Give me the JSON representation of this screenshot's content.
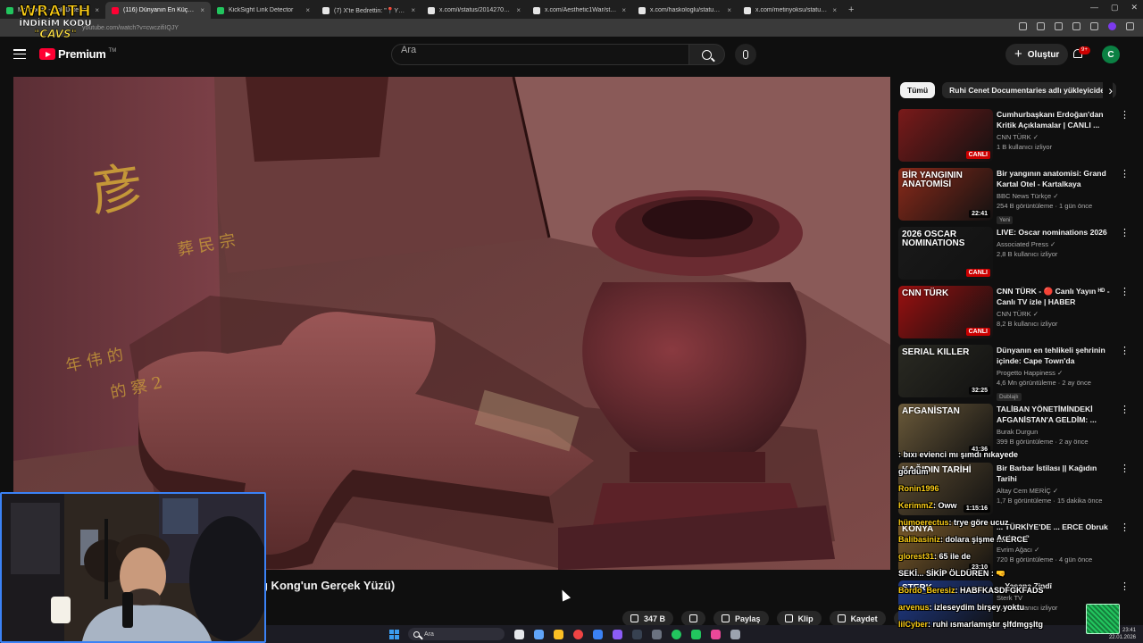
{
  "browser": {
    "tabs": [
      {
        "title": "MrNobody - Link Detector",
        "color": "#22c55e"
      },
      {
        "title": "(116) Dünyanın En Küçük Evi",
        "color": "#ff0033",
        "active": true
      },
      {
        "title": "KickSight Link Detector",
        "color": "#22c55e"
      },
      {
        "title": "(7) X'te Bedrettin: \"📍YENİ — ...",
        "color": "#e5e5e5"
      },
      {
        "title": "x.com/i/status/2014270035037",
        "color": "#e5e5e5"
      },
      {
        "title": "x.com/Aesthetic1War/status/20",
        "color": "#e5e5e5"
      },
      {
        "title": "x.com/haskologlu/status/2014",
        "color": "#e5e5e5"
      },
      {
        "title": "x.com/metinyoksu/status/2014",
        "color": "#e5e5e5"
      }
    ],
    "new_tab": "+",
    "tab_close": "×",
    "url": "youtube.com/watch?v=cwczifiIQJY",
    "window_controls": [
      "—",
      "▢",
      "✕"
    ]
  },
  "overlay_brand": {
    "line1": "WRAITH",
    "line2": "İNDİRİM KODU",
    "line3": "\"CAVS\""
  },
  "header": {
    "logo_text": "Premium",
    "logo_tm": "TM",
    "search_placeholder": "Ara",
    "create_label": "Oluştur",
    "create_plus": "+",
    "notification_badge": "9+",
    "account_initial": "C"
  },
  "video": {
    "title": "g Kong'un Gerçek Yüzü)",
    "actions": {
      "like_count": "347 B",
      "share_label": "Paylaş",
      "clip_label": "Klip",
      "save_label": "Kaydet",
      "more": "⋯"
    }
  },
  "sidebar": {
    "chips": [
      "Tümü",
      "Ruhi Cenet Documentaries adlı yükleyiciden"
    ],
    "chip_next": "›",
    "kebab": "⋮",
    "recommendations": [
      {
        "thumb_text": "",
        "badge": "CANLI",
        "bg": "#7a1a1a",
        "title": "Cumhurbaşkanı Erdoğan'dan Kritik Açıklamalar | CANLI ...",
        "channel": "CNN TÜRK ✓",
        "meta": "1 B kullanıcı izliyor",
        "extra": ""
      },
      {
        "thumb_text": "BİR YANGININ ANATOMİSİ",
        "badge": "22:41",
        "bg": "#8a2a1a",
        "title": "Bir yangının anatomisi: Grand Kartal Otel - Kartalkaya",
        "channel": "BBC News Türkçe ✓",
        "meta": "254 B görüntüleme · 1 gün önce",
        "extra": "Yeni"
      },
      {
        "thumb_text": "2026 OSCAR NOMINATIONS",
        "badge": "CANLI",
        "bg": "#1a1a1a",
        "title": "LIVE: Oscar nominations 2026",
        "channel": "Associated Press ✓",
        "meta": "2,8 B kullanıcı izliyor",
        "extra": ""
      },
      {
        "thumb_text": "CNN TÜRK",
        "badge": "CANLI",
        "bg": "#9a1010",
        "title": "CNN TÜRK - 🔴 Canlı Yayın ᴴᴰ - Canlı TV izle | HABER",
        "channel": "CNN TÜRK ✓",
        "meta": "8,2 B kullanıcı izliyor",
        "extra": ""
      },
      {
        "thumb_text": "SERIAL KILLER",
        "badge": "32:25",
        "bg": "#2a2a22",
        "title": "Dünyanın en tehlikeli şehrinin içinde: Cape Town'da yaşamak...",
        "channel": "Progetto Happiness ✓",
        "meta": "4,6 Mn görüntüleme · 2 ay önce",
        "extra": "Dublajlı"
      },
      {
        "thumb_text": "AFGANİSTAN",
        "badge": "41:36",
        "bg": "#6b5a3a",
        "title": "TALİBAN YÖNETİMİNDEKİ AFGANİSTAN'A GELDİM: ...",
        "channel": "Burak Durgun",
        "meta": "399 B görüntüleme · 2 ay önce",
        "extra": ""
      },
      {
        "thumb_text": "KAĞIDIN TARİHİ",
        "badge": "1:15:16",
        "bg": "#5a4a30",
        "title": "Bir Barbar İstilası || Kağıdın Tarihi",
        "channel": "Altay Cem MERİÇ ✓",
        "meta": "1,7 B görüntüleme · 15 dakika önce",
        "extra": ""
      },
      {
        "thumb_text": "KONYA",
        "badge": "23:10",
        "bg": "#7a5a2a",
        "title": "... TÜRKİYE'DE ... ERCE Obruk Açılıyor?",
        "channel": "Evrim Ağacı ✓",
        "meta": "720 B görüntüleme · 4 gün önce",
        "extra": ""
      },
      {
        "thumb_text": "STERK",
        "badge": "",
        "bg": "#1e3a8a",
        "title": "... Yaşana Zindî",
        "channel": "Sterk TV",
        "meta": "2,4 B kullanıcı izliyor",
        "extra": ""
      }
    ]
  },
  "chat": [
    {
      "user": "",
      "text": ": bıxı evienci mı şımdı nıkayede"
    },
    {
      "user": "",
      "text": "gördüm"
    },
    {
      "user": "Ronin1996",
      "text": ""
    },
    {
      "user": "KerimmZ",
      "text": ": Oww"
    },
    {
      "user": "hümoerectus",
      "text": ": trye göre ucuz"
    },
    {
      "user": "Balibasiniz",
      "text": ": dolara şişme ... ERCE"
    },
    {
      "user": "glorest31",
      "text": ": 65 ile de"
    },
    {
      "user": "",
      "text": "SEKİ... SİKİP ÖLDÜREN : 🤜"
    },
    {
      "user": "Bordo_Beresiz",
      "text": ": HABFKASDFGKFADS"
    },
    {
      "user": "arvenus",
      "text": ": izleseydim birşey yoktu"
    },
    {
      "user": "lilCyber",
      "text": ": ruhi ısmarlamıştır şlfdmgşltg"
    }
  ],
  "taskbar": {
    "search_placeholder": "Ara",
    "time": "23:41",
    "date": "22.01.2026"
  }
}
